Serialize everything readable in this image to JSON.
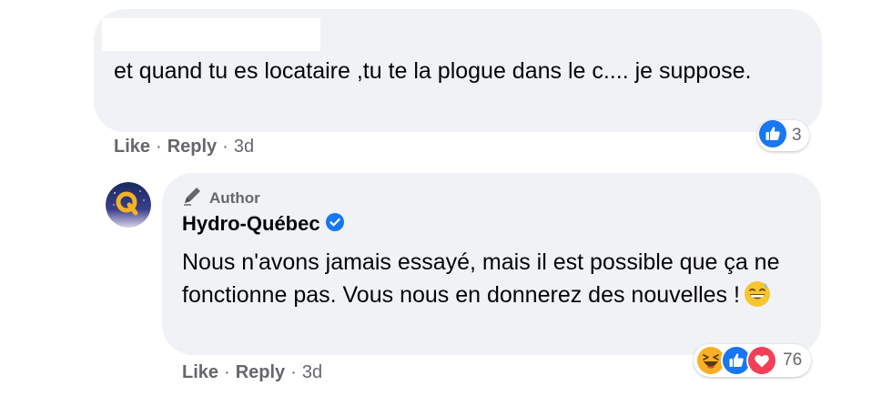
{
  "comment": {
    "text": "et quand tu es locataire ,tu te la plogue dans le c.... je suppose.",
    "reaction_count": "3",
    "reaction_icons": [
      "like-icon"
    ],
    "actions": {
      "like": "Like",
      "reply": "Reply",
      "time": "3d"
    }
  },
  "reply": {
    "badge": "Author",
    "author": "Hydro-Québec",
    "verified": true,
    "text": "Nous n'avons jamais essayé, mais il est possible que ça ne fonctionne pas. Vous nous en donnerez des nouvelles !",
    "emoji": "grinning-sweat-emoji",
    "reaction_count": "76",
    "reaction_icons": [
      "haha-icon",
      "like-icon",
      "love-icon"
    ],
    "actions": {
      "like": "Like",
      "reply": "Reply",
      "time": "3d"
    }
  },
  "separator": "·",
  "colors": {
    "bubble": "#f0f2f5",
    "secondary_text": "#65676b",
    "like_blue": "#1877f2",
    "love_red": "#f33e58",
    "haha_yellow": "#f7b125"
  }
}
